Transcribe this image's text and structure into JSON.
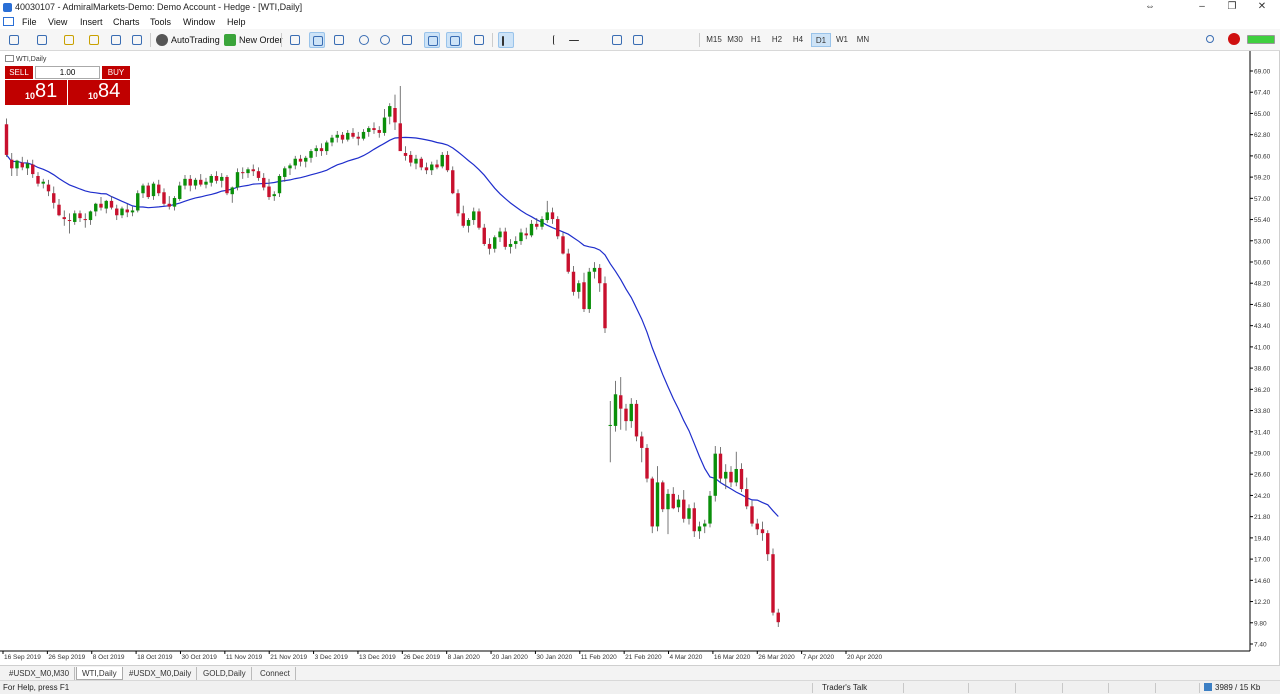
{
  "window": {
    "title": "40030107 - AdmiralMarkets-Demo: Demo Account - Hedge - [WTI,Daily]",
    "controls": [
      "–",
      "❐",
      "✕"
    ]
  },
  "menu": [
    "File",
    "View",
    "Insert",
    "Charts",
    "Tools",
    "Window",
    "Help"
  ],
  "toolbar": {
    "autotrading_label": "AutoTrading",
    "new_order_label": "New Order",
    "timeframes": [
      "M15",
      "M30",
      "H1",
      "H2",
      "H4",
      "D1",
      "W1",
      "MN"
    ],
    "active_timeframe": "D1"
  },
  "chart": {
    "label": "WTI,Daily",
    "trade_panel": {
      "sell_label": "SELL",
      "buy_label": "BUY",
      "lot": "1.00",
      "sell_price_small": "10",
      "sell_price_big": "81",
      "buy_price_small": "10",
      "buy_price_big": "84"
    },
    "colors": {
      "bull": "#0a8f0a",
      "bear": "#c8102e",
      "wick": "#555555",
      "ma": "#1f2ecc",
      "background": "#ffffff"
    }
  },
  "chart_data": {
    "type": "candlestick",
    "symbol": "WTI",
    "timeframe": "Daily",
    "ylim": [
      7.8,
      69.0
    ],
    "y_ticks": [
      "69.00",
      "67.40",
      "65.00",
      "62.80",
      "60.60",
      "59.20",
      "57.00",
      "55.40",
      "53.00",
      "50.60",
      "48.20",
      "45.80",
      "43.40",
      "41.00",
      "38.60",
      "36.20",
      "33.80",
      "31.40",
      "29.00",
      "26.60",
      "24.20",
      "21.80",
      "19.40",
      "17.00",
      "14.60",
      "12.20",
      "9.80",
      "7.40"
    ],
    "x_ticks": [
      "16 Sep 2019",
      "26 Sep 2019",
      "8 Oct 2019",
      "18 Oct 2019",
      "30 Oct 2019",
      "11 Nov 2019",
      "21 Nov 2019",
      "3 Dec 2019",
      "13 Dec 2019",
      "26 Dec 2019",
      "8 Jan 2020",
      "20 Jan 2020",
      "30 Jan 2020",
      "11 Feb 2020",
      "21 Feb 2020",
      "4 Mar 2020",
      "16 Mar 2020",
      "26 Mar 2020",
      "7 Apr 2020",
      "20 Apr 2020"
    ],
    "ohlc": [
      [
        62.6,
        63.2,
        59.2,
        59.4
      ],
      [
        58.9,
        59.6,
        57.2,
        58.0
      ],
      [
        58.0,
        58.9,
        57.2,
        58.8
      ],
      [
        58.6,
        59.2,
        57.8,
        58.1
      ],
      [
        58.0,
        58.9,
        57.3,
        58.5
      ],
      [
        58.4,
        58.9,
        57.0,
        57.4
      ],
      [
        57.2,
        57.6,
        56.1,
        56.4
      ],
      [
        56.4,
        56.9,
        55.9,
        56.6
      ],
      [
        56.3,
        56.8,
        55.1,
        55.6
      ],
      [
        55.4,
        56.1,
        53.8,
        54.4
      ],
      [
        54.2,
        54.8,
        53.0,
        53.1
      ],
      [
        52.9,
        53.6,
        52.0,
        52.7
      ],
      [
        52.6,
        53.3,
        51.2,
        52.5
      ],
      [
        52.4,
        53.6,
        52.1,
        53.3
      ],
      [
        53.3,
        53.6,
        52.4,
        52.8
      ],
      [
        52.7,
        53.3,
        51.8,
        52.6
      ],
      [
        52.6,
        53.6,
        52.1,
        53.5
      ],
      [
        53.5,
        54.4,
        53.0,
        54.3
      ],
      [
        54.3,
        55.0,
        53.6,
        53.9
      ],
      [
        53.8,
        54.7,
        53.3,
        54.6
      ],
      [
        54.6,
        55.1,
        53.7,
        53.9
      ],
      [
        53.8,
        54.2,
        52.6,
        53.1
      ],
      [
        53.1,
        54.0,
        52.8,
        53.8
      ],
      [
        53.7,
        54.3,
        52.9,
        53.4
      ],
      [
        53.4,
        54.0,
        53.0,
        53.6
      ],
      [
        53.6,
        55.7,
        53.4,
        55.4
      ],
      [
        55.4,
        56.4,
        54.9,
        56.2
      ],
      [
        56.2,
        56.5,
        54.8,
        55.0
      ],
      [
        55.1,
        56.6,
        54.7,
        56.4
      ],
      [
        56.3,
        56.8,
        55.1,
        55.4
      ],
      [
        55.5,
        55.9,
        54.1,
        54.3
      ],
      [
        54.3,
        55.1,
        53.7,
        54.0
      ],
      [
        54.0,
        55.1,
        53.6,
        54.9
      ],
      [
        54.8,
        56.6,
        54.6,
        56.2
      ],
      [
        56.2,
        57.3,
        55.8,
        56.9
      ],
      [
        56.9,
        57.3,
        55.6,
        56.2
      ],
      [
        56.2,
        57.0,
        55.8,
        56.8
      ],
      [
        56.8,
        57.4,
        56.1,
        56.3
      ],
      [
        56.3,
        57.0,
        55.9,
        56.6
      ],
      [
        56.5,
        57.4,
        56.1,
        57.2
      ],
      [
        57.2,
        57.7,
        56.4,
        56.7
      ],
      [
        56.7,
        57.5,
        56.0,
        57.1
      ],
      [
        57.1,
        57.3,
        55.2,
        55.4
      ],
      [
        55.3,
        56.1,
        54.4,
        56.0
      ],
      [
        56.0,
        58.0,
        55.7,
        57.6
      ],
      [
        57.6,
        58.1,
        56.9,
        57.5
      ],
      [
        57.5,
        58.1,
        57.0,
        57.9
      ],
      [
        57.9,
        58.4,
        57.2,
        57.7
      ],
      [
        57.7,
        58.1,
        56.7,
        57.0
      ],
      [
        57.0,
        57.5,
        55.7,
        56.0
      ],
      [
        56.1,
        56.9,
        54.7,
        55.0
      ],
      [
        55.1,
        55.6,
        54.6,
        55.3
      ],
      [
        55.4,
        57.4,
        55.0,
        57.2
      ],
      [
        57.1,
        58.2,
        56.6,
        58.0
      ],
      [
        58.0,
        58.5,
        57.3,
        58.3
      ],
      [
        58.3,
        59.3,
        57.9,
        59.0
      ],
      [
        59.0,
        59.4,
        58.2,
        58.7
      ],
      [
        58.7,
        59.3,
        58.1,
        59.1
      ],
      [
        59.1,
        60.0,
        58.6,
        59.8
      ],
      [
        59.8,
        60.4,
        59.2,
        60.1
      ],
      [
        60.1,
        60.6,
        59.3,
        59.8
      ],
      [
        59.8,
        60.9,
        59.4,
        60.7
      ],
      [
        60.7,
        61.5,
        60.3,
        61.2
      ],
      [
        61.2,
        61.9,
        60.7,
        61.5
      ],
      [
        61.5,
        61.8,
        60.6,
        61.0
      ],
      [
        61.0,
        62.0,
        60.8,
        61.7
      ],
      [
        61.7,
        62.2,
        61.1,
        61.3
      ],
      [
        61.3,
        61.8,
        60.4,
        61.1
      ],
      [
        61.1,
        62.1,
        60.9,
        61.8
      ],
      [
        61.8,
        62.4,
        61.3,
        62.2
      ],
      [
        62.2,
        62.8,
        61.6,
        62.0
      ],
      [
        62.0,
        62.4,
        61.2,
        61.7
      ],
      [
        61.7,
        64.2,
        61.4,
        63.3
      ],
      [
        63.4,
        64.8,
        62.6,
        64.5
      ],
      [
        64.3,
        65.7,
        62.0,
        62.8
      ],
      [
        62.7,
        66.6,
        61.4,
        59.8
      ],
      [
        59.6,
        60.3,
        58.8,
        59.3
      ],
      [
        59.4,
        59.8,
        58.2,
        58.6
      ],
      [
        58.5,
        59.4,
        57.9,
        59.0
      ],
      [
        59.0,
        59.2,
        57.8,
        58.1
      ],
      [
        58.1,
        58.6,
        57.4,
        57.8
      ],
      [
        57.8,
        58.7,
        57.3,
        58.4
      ],
      [
        58.4,
        58.9,
        57.9,
        58.1
      ],
      [
        58.2,
        59.7,
        58.0,
        59.4
      ],
      [
        59.4,
        59.8,
        57.6,
        57.8
      ],
      [
        57.8,
        58.2,
        55.3,
        55.4
      ],
      [
        55.4,
        55.8,
        53.0,
        53.3
      ],
      [
        53.3,
        54.1,
        51.8,
        52.0
      ],
      [
        52.0,
        52.8,
        51.3,
        52.6
      ],
      [
        52.6,
        53.9,
        52.1,
        53.5
      ],
      [
        53.5,
        53.8,
        51.6,
        51.8
      ],
      [
        51.8,
        52.2,
        49.9,
        50.1
      ],
      [
        50.1,
        50.7,
        49.0,
        49.6
      ],
      [
        49.6,
        51.0,
        49.2,
        50.8
      ],
      [
        50.8,
        51.8,
        50.3,
        51.4
      ],
      [
        51.4,
        51.8,
        49.5,
        49.8
      ],
      [
        49.8,
        50.6,
        49.1,
        50.1
      ],
      [
        50.1,
        50.9,
        49.6,
        50.4
      ],
      [
        50.4,
        51.7,
        50.0,
        51.3
      ],
      [
        51.2,
        51.8,
        50.6,
        51.0
      ],
      [
        51.0,
        52.6,
        50.8,
        52.2
      ],
      [
        52.2,
        52.8,
        51.6,
        51.9
      ],
      [
        51.9,
        53.0,
        51.6,
        52.7
      ],
      [
        52.6,
        54.6,
        52.3,
        53.4
      ],
      [
        53.4,
        53.9,
        52.2,
        52.7
      ],
      [
        52.7,
        53.0,
        50.6,
        50.9
      ],
      [
        50.9,
        51.3,
        49.0,
        49.1
      ],
      [
        49.1,
        49.6,
        47.0,
        47.2
      ],
      [
        47.2,
        47.8,
        44.7,
        45.1
      ],
      [
        45.1,
        46.3,
        44.4,
        46.0
      ],
      [
        46.1,
        47.1,
        43.0,
        43.3
      ],
      [
        43.3,
        47.6,
        42.9,
        47.2
      ],
      [
        47.2,
        48.2,
        46.5,
        47.6
      ],
      [
        47.6,
        48.0,
        45.1,
        46.0
      ],
      [
        46.0,
        46.7,
        40.8,
        41.3
      ],
      [
        31.1,
        33.7,
        27.3,
        31.2
      ],
      [
        31.1,
        35.8,
        30.5,
        34.4
      ],
      [
        34.3,
        36.2,
        30.7,
        32.9
      ],
      [
        32.9,
        33.4,
        30.6,
        31.6
      ],
      [
        31.6,
        34.0,
        30.9,
        33.4
      ],
      [
        33.4,
        33.8,
        29.5,
        30.0
      ],
      [
        30.0,
        30.5,
        27.3,
        28.8
      ],
      [
        28.8,
        29.2,
        25.2,
        25.6
      ],
      [
        25.6,
        25.8,
        19.9,
        20.6
      ],
      [
        20.6,
        26.9,
        20.1,
        25.2
      ],
      [
        25.2,
        25.4,
        22.1,
        22.4
      ],
      [
        22.4,
        24.5,
        19.8,
        24.0
      ],
      [
        24.0,
        24.7,
        22.4,
        22.5
      ],
      [
        22.6,
        23.9,
        22.1,
        23.4
      ],
      [
        23.4,
        24.4,
        21.0,
        21.4
      ],
      [
        21.4,
        22.9,
        20.8,
        22.5
      ],
      [
        22.5,
        23.1,
        19.5,
        20.1
      ],
      [
        20.1,
        21.1,
        19.3,
        20.6
      ],
      [
        20.6,
        21.3,
        19.9,
        20.9
      ],
      [
        20.9,
        24.3,
        20.5,
        23.8
      ],
      [
        23.8,
        29.0,
        23.2,
        28.2
      ],
      [
        28.2,
        28.9,
        25.2,
        25.6
      ],
      [
        25.6,
        27.1,
        24.5,
        26.3
      ],
      [
        26.3,
        26.9,
        24.7,
        25.2
      ],
      [
        25.2,
        28.4,
        24.8,
        26.6
      ],
      [
        26.6,
        27.2,
        24.2,
        24.5
      ],
      [
        24.5,
        25.7,
        22.4,
        22.7
      ],
      [
        22.7,
        23.3,
        20.6,
        20.9
      ],
      [
        20.9,
        21.4,
        19.7,
        20.3
      ],
      [
        20.3,
        21.1,
        19.1,
        19.9
      ],
      [
        19.9,
        20.2,
        17.0,
        17.7
      ],
      [
        17.7,
        18.3,
        11.3,
        11.6
      ],
      [
        11.6,
        12.0,
        10.1,
        10.6
      ]
    ],
    "ma": {
      "name": "",
      "values": []
    }
  }
}
